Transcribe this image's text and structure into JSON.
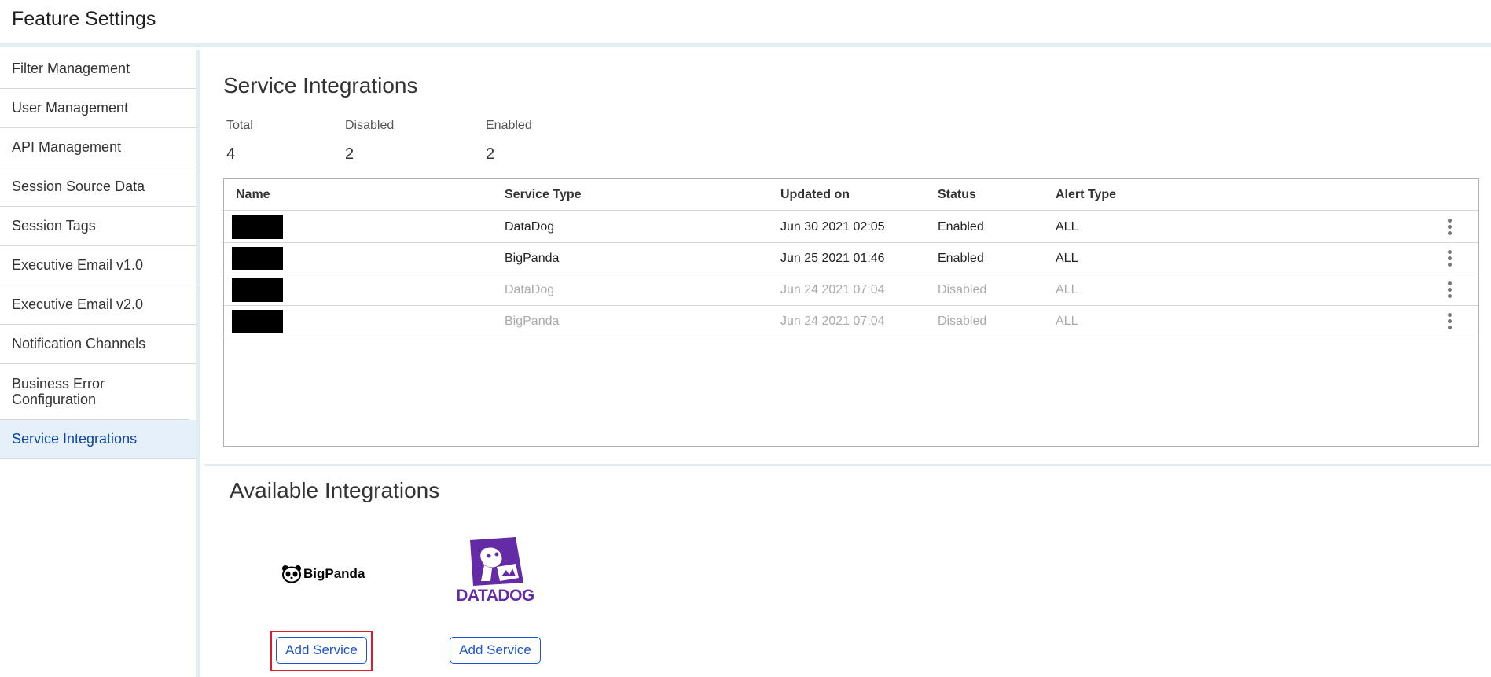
{
  "header": {
    "title": "Feature Settings"
  },
  "sidebar": {
    "items": [
      {
        "label": "Filter Management"
      },
      {
        "label": "User Management"
      },
      {
        "label": "API Management"
      },
      {
        "label": "Session Source Data"
      },
      {
        "label": "Session Tags"
      },
      {
        "label": "Executive Email v1.0"
      },
      {
        "label": "Executive Email v2.0"
      },
      {
        "label": "Notification Channels"
      },
      {
        "label": "Business Error Configuration"
      },
      {
        "label": "Service Integrations",
        "active": true
      }
    ]
  },
  "main": {
    "title": "Service Integrations",
    "stats": [
      {
        "label": "Total",
        "value": "4"
      },
      {
        "label": "Disabled",
        "value": "2"
      },
      {
        "label": "Enabled",
        "value": "2"
      }
    ],
    "table": {
      "columns": [
        "Name",
        "Service Type",
        "Updated on",
        "Status",
        "Alert Type"
      ],
      "rows": [
        {
          "service_type": "DataDog",
          "updated_on": "Jun 30 2021 02:05",
          "status": "Enabled",
          "alert_type": "ALL"
        },
        {
          "service_type": "BigPanda",
          "updated_on": "Jun 25 2021 01:46",
          "status": "Enabled",
          "alert_type": "ALL"
        },
        {
          "service_type": "DataDog",
          "updated_on": "Jun 24 2021 07:04",
          "status": "Disabled",
          "alert_type": "ALL"
        },
        {
          "service_type": "BigPanda",
          "updated_on": "Jun 24 2021 07:04",
          "status": "Disabled",
          "alert_type": "ALL"
        }
      ]
    }
  },
  "available": {
    "title": "Available Integrations",
    "integrations": [
      {
        "logo_text": "BigPanda",
        "button_label": "Add Service",
        "logo_color": "#000000"
      },
      {
        "logo_text": "DATADOG",
        "button_label": "Add Service",
        "logo_color": "#632ca6"
      }
    ]
  },
  "colors": {
    "accent": "#1e54c9",
    "active_bg": "#e5f0fa",
    "highlight": "#e3182d",
    "datadog_purple": "#632ca6"
  }
}
